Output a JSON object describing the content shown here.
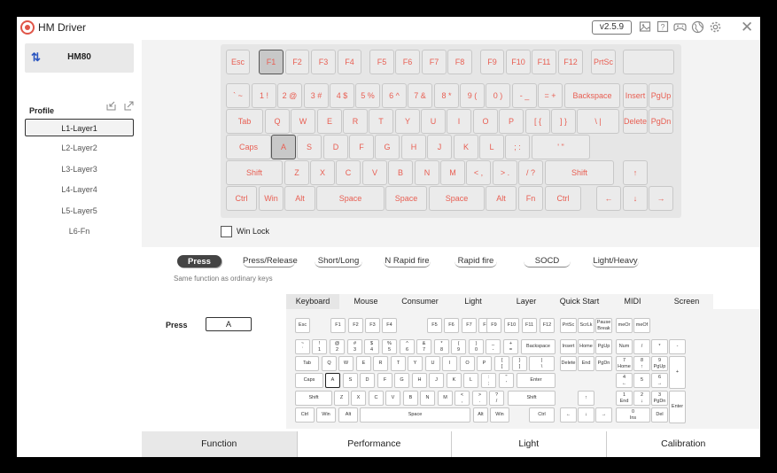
{
  "app": {
    "title": "HM Driver",
    "version": "v2.5.9"
  },
  "titlebar_icons": [
    "image-icon",
    "help-icon",
    "gamepad-icon",
    "globe-icon",
    "gear-icon"
  ],
  "device": {
    "name": "HM80"
  },
  "profile": {
    "label": "Profile"
  },
  "layers": [
    "L1-Layer1",
    "L2-Layer2",
    "L3-Layer3",
    "L4-Layer4",
    "L5-Layer5",
    "L6-Fn"
  ],
  "selected_layer": "L1-Layer1",
  "keyboard": {
    "accent": "#e85e52",
    "rows": [
      [
        "Esc",
        "F1",
        "F2",
        "F3",
        "F4",
        "F5",
        "F6",
        "F7",
        "F8",
        "F9",
        "F10",
        "F11",
        "F12",
        "PrtSc",
        ""
      ],
      [
        "` ~",
        "1 !",
        "2 @",
        "3 #",
        "4 $",
        "5 %",
        "6 ^",
        "7 &",
        "8 *",
        "9 (",
        "0 )",
        "- _",
        "= +",
        "Backspace",
        "Insert",
        "PgUp"
      ],
      [
        "Tab",
        "Q",
        "W",
        "E",
        "R",
        "T",
        "Y",
        "U",
        "I",
        "O",
        "P",
        "[ {",
        "] }",
        "\\ |",
        "Delete",
        "PgDn"
      ],
      [
        "Caps",
        "A",
        "S",
        "D",
        "F",
        "G",
        "H",
        "J",
        "K",
        "L",
        "; :",
        "' \"",
        "Enter"
      ],
      [
        "Shift",
        "Z",
        "X",
        "C",
        "V",
        "B",
        "N",
        "M",
        "< ,",
        "> .",
        "/ ?",
        "Shift",
        "↑"
      ],
      [
        "Ctrl",
        "Win",
        "Alt",
        "Space",
        "Space",
        "Space",
        "Alt",
        "Fn",
        "Ctrl",
        "←",
        "↓",
        "→"
      ]
    ],
    "selected_keys": [
      "F1",
      "A"
    ]
  },
  "win_lock": {
    "label": "Win Lock",
    "checked": false
  },
  "function_tabs": [
    "Press",
    "Press/Release",
    "Short/Long",
    "N Rapid fire",
    "Rapid fire",
    "SOCD",
    "Light/Heavy"
  ],
  "active_function_tab": "Press",
  "function_desc": "Same function as ordinary keys",
  "press": {
    "label": "Press",
    "value": "A"
  },
  "category_tabs": [
    "Keyboard",
    "Mouse",
    "Consumer",
    "Light",
    "Layer",
    "Quick Start",
    "MIDI",
    "Screen"
  ],
  "active_category_tab": "Keyboard",
  "mini_keyboard": {
    "rows": [
      [
        "Esc",
        "F1",
        "F2",
        "F3",
        "F4",
        "F5",
        "F6",
        "F7",
        "F8",
        "F9",
        "F10",
        "F11",
        "F12",
        "PrtSc",
        "ScrLk",
        "Pause\nBreak",
        "meOr",
        "meOf"
      ],
      [
        "~\n`",
        "!\n1",
        "@\n2",
        "#\n3",
        "$\n4",
        "%\n5",
        "^\n6",
        "&\n7",
        "*\n8",
        "(\n9",
        ")\n0",
        "_\n-",
        "+\n=",
        "Backspace",
        "Insert",
        "Home",
        "PgUp",
        "Num",
        "/",
        "*",
        "-"
      ],
      [
        "Tab",
        "Q",
        "W",
        "E",
        "R",
        "T",
        "Y",
        "U",
        "I",
        "O",
        "P",
        "{\n[",
        "}\n]",
        "|\n\\",
        "Delete",
        "End",
        "PgDn",
        "7\nHome",
        "8\n↑",
        "9\nPgUp",
        "+"
      ],
      [
        "Caps",
        "A",
        "S",
        "D",
        "F",
        "G",
        "H",
        "J",
        "K",
        "L",
        ":\n;",
        "\"\n'",
        "Enter",
        "4\n←",
        "5",
        "6\n→"
      ],
      [
        "Shift",
        "Z",
        "X",
        "C",
        "V",
        "B",
        "N",
        "M",
        "<\n,",
        ">\n.",
        "?\n/",
        "Shift",
        "↑",
        "1\nEnd",
        "2\n↓",
        "3\nPgDn",
        "Enter"
      ],
      [
        "Ctrl",
        "Win",
        "Alt",
        "Space",
        "Alt",
        "Win",
        "Ctrl",
        "←",
        "↓",
        "→",
        "0\nIns",
        "Del"
      ]
    ],
    "selected_key": "A"
  },
  "bottom_tabs": [
    "Function",
    "Performance",
    "Light",
    "Calibration"
  ],
  "active_bottom_tab": "Function"
}
